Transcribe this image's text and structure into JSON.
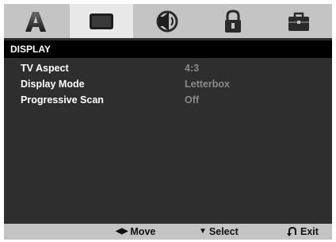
{
  "tabs": [
    {
      "name": "language",
      "icon": "letter-a-icon",
      "active": false
    },
    {
      "name": "display",
      "icon": "display-screen-icon",
      "active": true
    },
    {
      "name": "audio",
      "icon": "speaker-icon",
      "active": false
    },
    {
      "name": "lock",
      "icon": "padlock-icon",
      "active": false
    },
    {
      "name": "others",
      "icon": "briefcase-icon",
      "active": false
    }
  ],
  "panel": {
    "title": "DISPLAY",
    "rows": [
      {
        "label": "TV Aspect",
        "value": "4:3"
      },
      {
        "label": "Display Mode",
        "value": "Letterbox"
      },
      {
        "label": "Progressive Scan",
        "value": "Off"
      }
    ]
  },
  "footer": {
    "move": {
      "glyph": "◀▶",
      "label": "Move"
    },
    "select": {
      "glyph": "▼",
      "label": "Select"
    },
    "exit": {
      "icon": "return-arrow-icon",
      "label": "Exit"
    }
  },
  "colors": {
    "panel_bg": "#2e2e2e",
    "tab_bar": "#c4c4c4",
    "active_tab": "#e8e8e8",
    "header_bg": "#000000",
    "label_text": "#ffffff",
    "value_text": "#8a8a8a"
  }
}
